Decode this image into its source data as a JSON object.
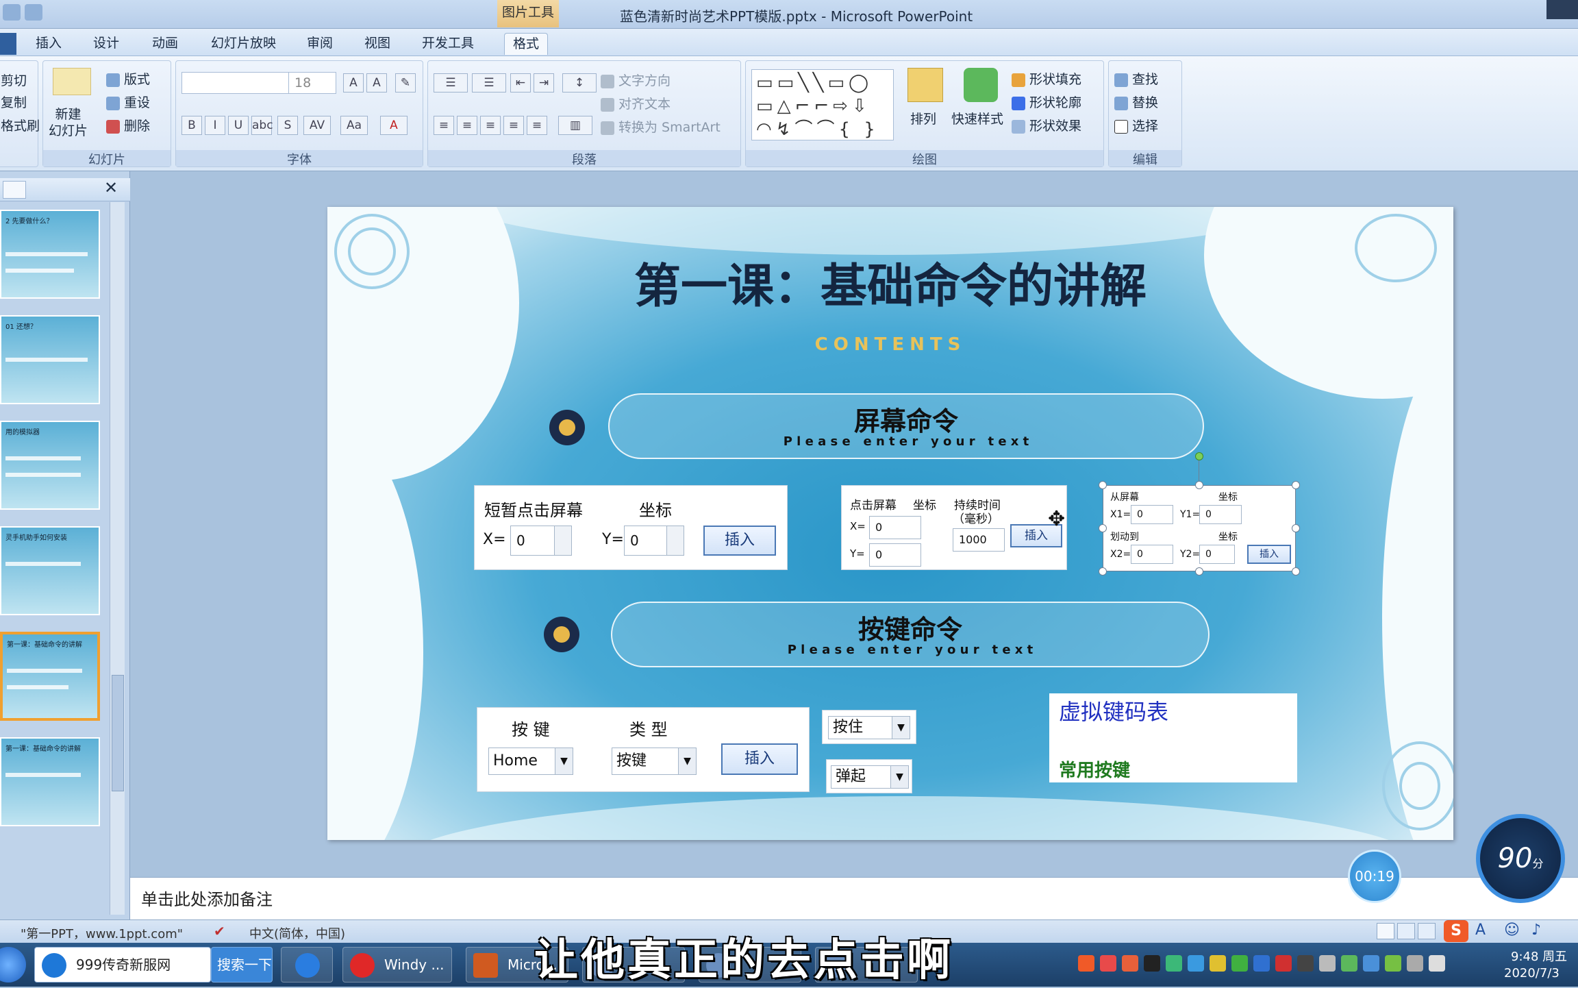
{
  "window": {
    "context_tab": "图片工具",
    "title": "蓝色清新时尚艺术PPT模版.pptx - Microsoft PowerPoint"
  },
  "ribbon_tabs": [
    "插入",
    "设计",
    "动画",
    "幻灯片放映",
    "审阅",
    "视图",
    "开发工具",
    "格式"
  ],
  "ribbon": {
    "clipboard": {
      "cut": "剪切",
      "copy": "复制",
      "format_painter": "格式刷"
    },
    "slides": {
      "new_slide": "新建\n幻灯片",
      "layout": "版式",
      "reset": "重设",
      "delete": "删除",
      "label": "幻灯片"
    },
    "font": {
      "size": "18",
      "label": "字体"
    },
    "paragraph": {
      "text_direction": "文字方向",
      "align_text": "对齐文本",
      "smartart": "转换为 SmartArt",
      "label": "段落"
    },
    "drawing": {
      "arrange": "排列",
      "quick_styles": "快速样式",
      "shape_fill": "形状填充",
      "shape_outline": "形状轮廓",
      "shape_effects": "形状效果",
      "label": "绘图"
    },
    "editing": {
      "find": "查找",
      "replace": "替换",
      "select": "选择",
      "label": "编辑"
    }
  },
  "slide": {
    "title": "第一课：基础命令的讲解",
    "subtitle": "CONTENTS",
    "section1": {
      "title": "屏幕命令",
      "sub": "P l e a s e   e n t e r   y o u r   t e x t"
    },
    "section2": {
      "title": "按键命令",
      "sub": "P l e a s e   e n t e r   y o u r   t e x t"
    },
    "tap_panel": {
      "label": "短暂点击屏幕",
      "coord": "坐标",
      "x_label": "X=",
      "x_val": "0",
      "y_label": "Y=",
      "y_val": "0",
      "insert": "插入"
    },
    "press_panel": {
      "label": "点击屏幕",
      "coord": "坐标",
      "duration": "持续时间",
      "ms": "（毫秒）",
      "x_label": "X=",
      "x_val": "0",
      "y_label": "Y=",
      "y_val": "0",
      "dur_val": "1000",
      "insert": "插入"
    },
    "swipe_panel": {
      "from": "从屏幕",
      "coord1": "坐标",
      "x1": "X1=",
      "x1v": "0",
      "y1": "Y1=",
      "y1v": "0",
      "to": "划动到",
      "coord2": "坐标",
      "x2": "X2=",
      "x2v": "0",
      "y2": "Y2=",
      "y2v": "0",
      "insert": "插入"
    },
    "key_panel": {
      "key": "按 键",
      "type": "类 型",
      "key_val": "Home",
      "type_val": "按键",
      "insert": "插入"
    },
    "hold": "按住",
    "release": "弹起",
    "vk_title": "虚拟键码表",
    "vk_common": "常用按键"
  },
  "thumbnails": [
    "2 先要做什么？",
    "01 还想？",
    "用的模拟器",
    "灵手机助手如何安装",
    "第一课：基础命令的讲解",
    "第一课：基础命令的讲解"
  ],
  "notes_placeholder": "单击此处添加备注",
  "status": {
    "theme": "\"第一PPT，www.1ppt.com\"",
    "language": "中文(简体，中国)"
  },
  "taskbar": {
    "browser": "999传奇新服网",
    "search": "搜索一下",
    "windy": "Windy ...",
    "ppt": "Micro...",
    "clock": "9:48 周五",
    "date": "2020/7/3"
  },
  "caption": "让他真正的去点击啊",
  "timer": "00:19",
  "gauge": "90",
  "gauge_unit": "分"
}
